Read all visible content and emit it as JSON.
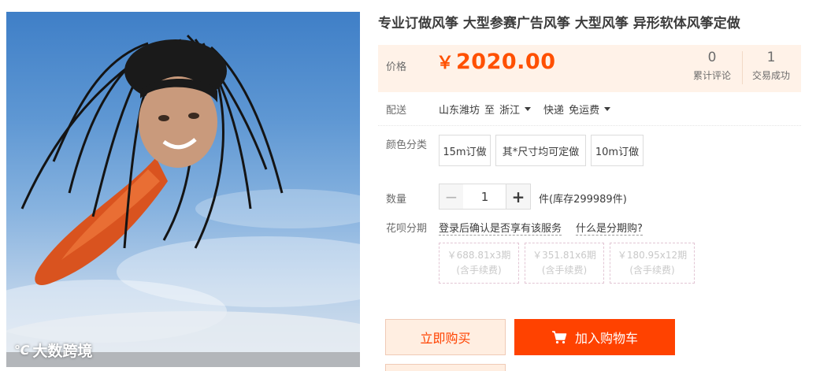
{
  "product": {
    "title": "专业订做风筝 大型参赛广告风筝 大型风筝 异形软体风筝定做"
  },
  "price": {
    "label": "价格",
    "currency_symbol": "￥",
    "amount": "2020.00",
    "color": "#ff5000"
  },
  "stats": {
    "reviews_count": "0",
    "reviews_label": "累计评论",
    "sales_count": "1",
    "sales_label": "交易成功"
  },
  "delivery": {
    "label": "配送",
    "origin": "山东潍坊",
    "to_word": "至",
    "destination": "浙江",
    "method": "快递",
    "fee": "免运费"
  },
  "color_options": {
    "label": "颜色分类",
    "options": [
      "15m订做",
      "其*尺寸均可定做",
      "10m订做"
    ]
  },
  "quantity": {
    "label": "数量",
    "minus": "−",
    "plus": "+",
    "value": "1",
    "stock_text": "件(库存299989件)"
  },
  "installment": {
    "label": "花呗分期",
    "login_link": "登录后确认是否享有该服务",
    "what_link": "什么是分期购?",
    "plans": [
      {
        "amount": "￥688.81x3期",
        "fee": "(含手续费)"
      },
      {
        "amount": "￥351.81x6期",
        "fee": "(含手续费)"
      },
      {
        "amount": "￥180.95x12期",
        "fee": "(含手续费)"
      }
    ]
  },
  "actions": {
    "buy_now": "立即购买",
    "add_to_cart": "加入购物车",
    "accent_color": "#ff4200"
  },
  "watermark": {
    "text": "大数跨境"
  },
  "icons": {
    "cart": "shopping-cart-icon",
    "dropdown": "chevron-down-icon"
  }
}
